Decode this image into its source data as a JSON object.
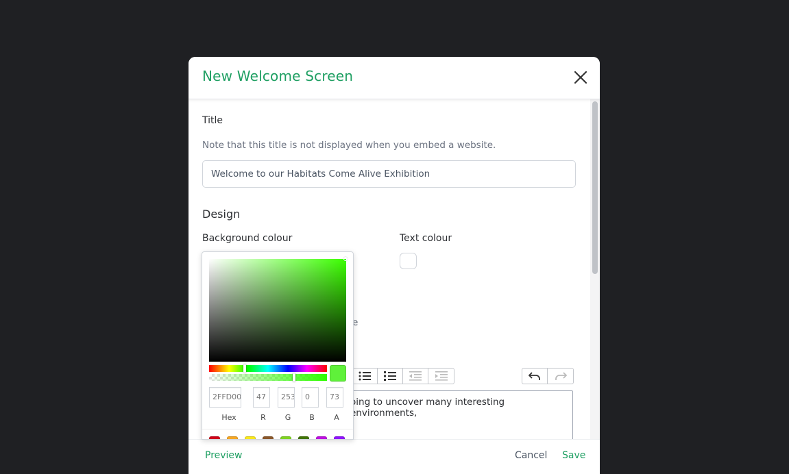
{
  "modal": {
    "title": "New Welcome Screen",
    "close_icon": "close-icon"
  },
  "form": {
    "title_label": "Title",
    "title_note": "Note that this title is not displayed when you embed a website.",
    "title_value": "Welcome to our Habitats Come Alive Exhibition",
    "design_heading": "Design",
    "background_colour_label": "Background colour",
    "text_colour_label": "Text colour",
    "partial_text_1": "e",
    "editor_text": "oing to uncover many interesting environments,"
  },
  "picker": {
    "hex": "2FFD00",
    "r": "47",
    "g": "253",
    "b": "0",
    "a": "73",
    "hex_label": "Hex",
    "r_label": "R",
    "g_label": "G",
    "b_label": "B",
    "a_label": "A",
    "presets": [
      "#d0021b",
      "#f5a623",
      "#f8e71c",
      "#8b572a",
      "#7ed321",
      "#417505",
      "#bd10e0",
      "#9013fe"
    ]
  },
  "toolbar": {
    "icons": [
      "bullet-list-icon",
      "numbered-list-icon",
      "outdent-icon",
      "indent-icon"
    ],
    "history_icons": [
      "undo-icon",
      "redo-icon"
    ]
  },
  "footer": {
    "preview_label": "Preview",
    "cancel_label": "Cancel",
    "save_label": "Save"
  },
  "colors": {
    "accent": "#1e9f62",
    "selected_colour": "#2FFD00"
  }
}
